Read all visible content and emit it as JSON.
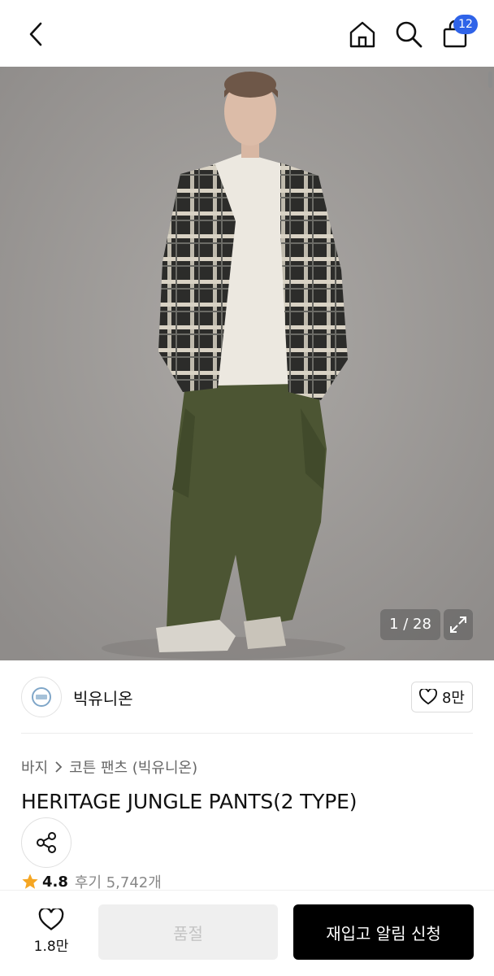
{
  "header": {
    "back_icon": "chevron-left-icon",
    "home_icon": "home-icon",
    "search_icon": "search-icon",
    "bag_icon": "shopping-bag-icon",
    "cart_count": "12"
  },
  "gallery": {
    "counter": "1 / 28",
    "expand_icon": "expand-icon",
    "current": 1,
    "total": 28
  },
  "brand": {
    "name": "빅유니온",
    "likes": "8만",
    "heart_icon": "heart-icon"
  },
  "product": {
    "breadcrumb": [
      "바지",
      "코튼 팬츠 (빅유니온)"
    ],
    "title": "HERITAGE JUNGLE PANTS(2 TYPE)",
    "share_icon": "share-icon",
    "rating": "4.8",
    "review_text": "후기 5,742개",
    "star_color": "#f5a623"
  },
  "bottom": {
    "like_count": "1.8만",
    "soldout_label": "품절",
    "restock_label": "재입고 알림 신청"
  },
  "colors": {
    "badge": "#2f63e8",
    "primary_button": "#000000",
    "disabled_button": "#efefef"
  }
}
